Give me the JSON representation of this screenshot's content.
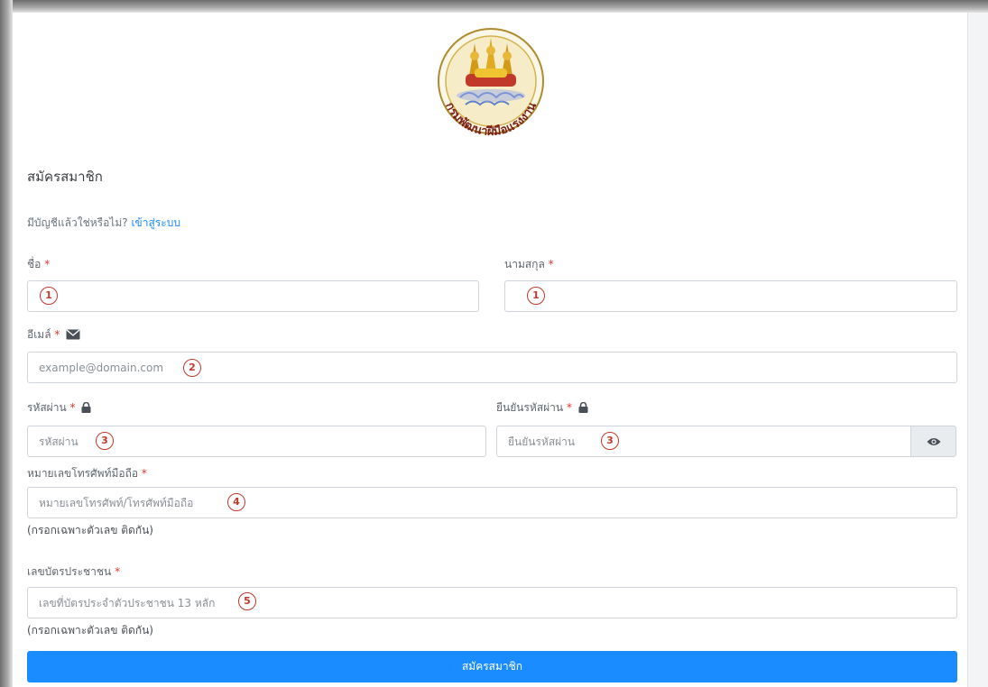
{
  "form": {
    "title": "สมัครสมาชิก",
    "login_prompt": "มีบัญชีแล้วใช่หรือไม่?",
    "login_link": "เข้าสู่ระบบ",
    "first_name": {
      "label": "ชื่อ",
      "required_mark": "*",
      "value": "",
      "placeholder": "",
      "annotation": "1"
    },
    "last_name": {
      "label": "นามสกุล",
      "required_mark": "*",
      "value": "",
      "placeholder": "",
      "annotation": "1"
    },
    "email": {
      "label": "อีเมล์",
      "required_mark": "*",
      "icon": "envelope-icon",
      "value": "",
      "placeholder": "example@domain.com",
      "annotation": "2"
    },
    "password": {
      "label": "รหัสผ่าน",
      "required_mark": "*",
      "icon": "lock-icon",
      "value": "",
      "placeholder": "รหัสผ่าน",
      "annotation": "3"
    },
    "confirm_password": {
      "label": "ยืนยันรหัสผ่าน",
      "required_mark": "*",
      "icon": "lock-icon",
      "value": "",
      "placeholder": "ยืนยันรหัสผ่าน",
      "annotation": "3",
      "toggle_icon": "eye-icon"
    },
    "phone": {
      "label": "หมายเลขโทรศัพท์มือถือ",
      "required_mark": "*",
      "value": "",
      "placeholder": "หมายเลขโทรศัพท์/โทรศัพท์มือถือ",
      "annotation": "4",
      "help": "(กรอกเฉพาะตัวเลข ติดกัน)"
    },
    "id_card": {
      "label": "เลขบัตรประชาชน",
      "required_mark": "*",
      "value": "",
      "placeholder": "เลขที่บัตรประจำตัวประชาชน 13 หลัก",
      "annotation": "5",
      "help": "(กรอกเฉพาะตัวเลข ติดกัน)"
    },
    "submit_label": "สมัครสมาชิก"
  },
  "logo": {
    "name": "department-seal-logo",
    "text": "กรมพัฒนาฝีมือแรงงาน"
  },
  "colors": {
    "primary": "#1a8cff",
    "required": "#e3342f",
    "annotation": "#c0392b",
    "input_border": "#ced4da"
  }
}
